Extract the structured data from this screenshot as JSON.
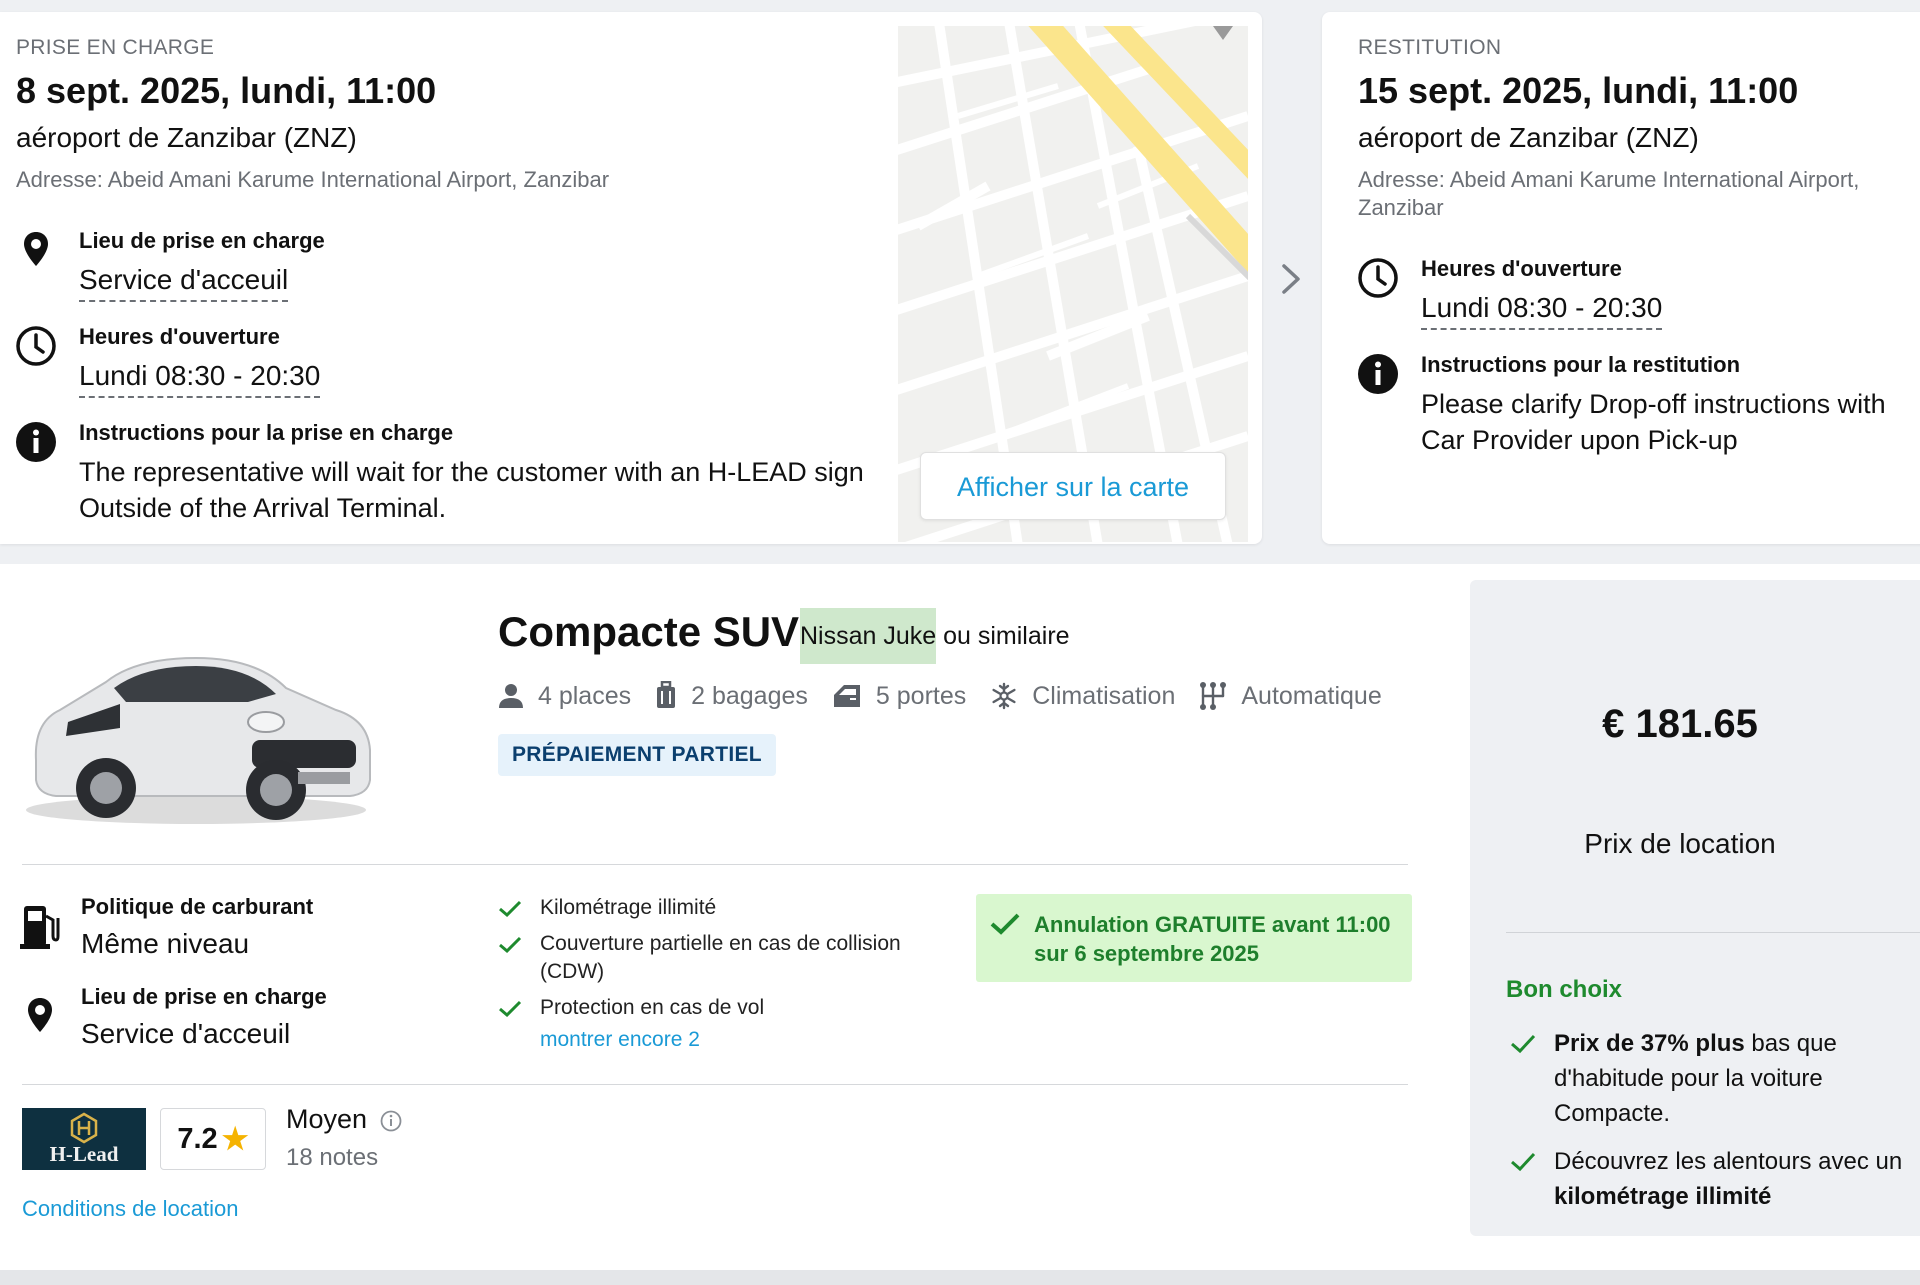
{
  "pickup": {
    "section_label": "PRISE EN CHARGE",
    "date": "8 sept. 2025, lundi, 11:00",
    "location": "aéroport de Zanzibar (ZNZ)",
    "address": "Adresse: Abeid Amani Karume International Airport, Zanzibar",
    "place_title": "Lieu de prise en charge",
    "place_value": "Service d'acceuil",
    "hours_title": "Heures d'ouverture",
    "hours_value": "Lundi 08:30 - 20:30",
    "instructions_title": "Instructions pour la prise en charge",
    "instructions_text": "The representative will wait for the customer with an H-LEAD sign Outside of the Arrival Terminal.",
    "map_button": "Afficher sur la carte"
  },
  "return": {
    "section_label": "RESTITUTION",
    "date": "15 sept. 2025, lundi, 11:00",
    "location": "aéroport de Zanzibar (ZNZ)",
    "address": "Adresse: Abeid Amani Karume International Airport, Zanzibar",
    "hours_title": "Heures d'ouverture",
    "hours_value": "Lundi 08:30 - 20:30",
    "instructions_title": "Instructions pour la restitution",
    "instructions_text": "Please clarify Drop-off instructions with Car Provider upon Pick-up"
  },
  "offer": {
    "category": "Compacte SUV",
    "model": "Nissan Juke",
    "model_suffix": " ou similaire",
    "specs": {
      "seats": "4 places",
      "bags": "2 bagages",
      "doors": "5 portes",
      "ac": "Climatisation",
      "transmission": "Automatique"
    },
    "badge": "PRÉPAIEMENT PARTIEL",
    "fuel_title": "Politique de carburant",
    "fuel_value": "Même niveau",
    "place_title": "Lieu de prise en charge",
    "place_value": "Service d'acceuil",
    "inclusions": [
      "Kilométrage illimité",
      "Couverture partielle en cas de collision (CDW)",
      "Protection en cas de vol"
    ],
    "more_link": "montrer encore 2",
    "cancellation": "Annulation GRATUITE avant 11:00 sur 6 septembre 2025",
    "supplier_logo_text": "H-Lead",
    "rating": "7.2",
    "rating_word": "Moyen",
    "rating_count": "18 notes",
    "conditions_link": "Conditions de location"
  },
  "price_panel": {
    "price": "€ 181.65",
    "price_label": "Prix de location",
    "good_choice": "Bon choix",
    "point1_bold": "Prix de 37% plus",
    "point1_rest": " bas que d'habitude pour la voiture Compacte.",
    "point2_text": "Découvrez les alentours avec un ",
    "point2_bold": "kilométrage illimité"
  },
  "colors": {
    "accent_link": "#1a9ad6",
    "success_green": "#1e8a2e",
    "cancel_bg": "#d9f7cf",
    "badge_bg": "#e6f2fb"
  }
}
